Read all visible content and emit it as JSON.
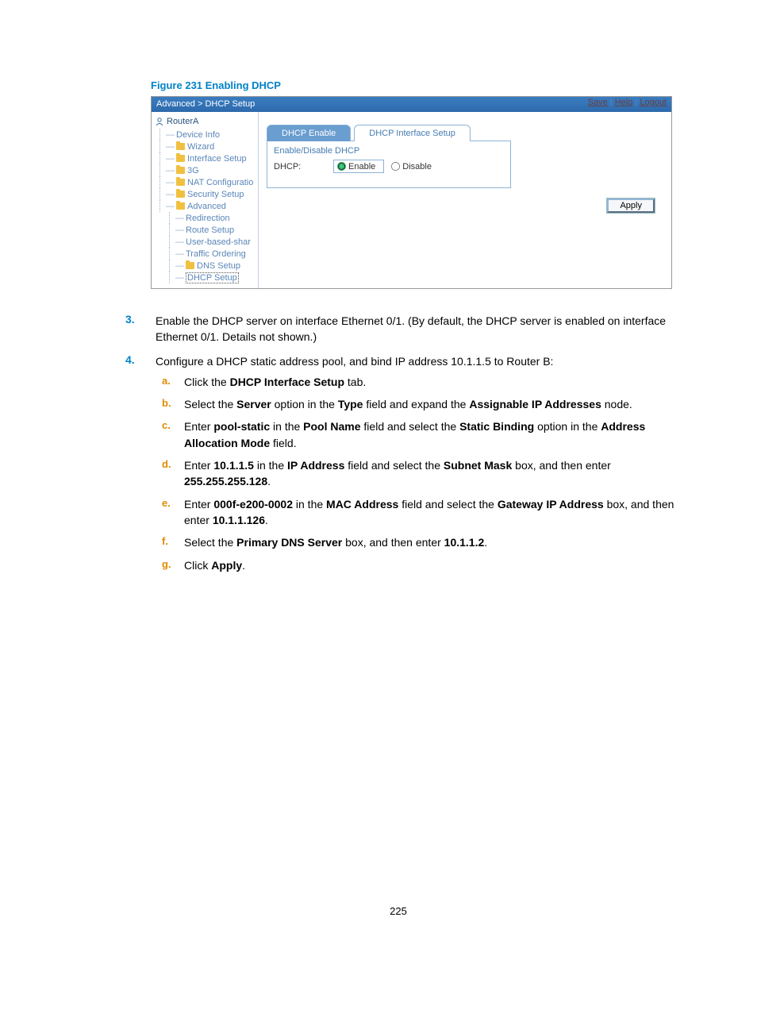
{
  "figure_title": "Figure 231 Enabling DHCP",
  "breadcrumb": "Advanced > DHCP Setup",
  "top_links": {
    "save": "Save",
    "help": "Help",
    "logout": "Logout"
  },
  "nav": {
    "root": "RouterA",
    "items": [
      {
        "label": "Device Info",
        "icon": null
      },
      {
        "label": "Wizard",
        "icon": "folder"
      },
      {
        "label": "Interface Setup",
        "icon": "folder"
      },
      {
        "label": "3G",
        "icon": "folder"
      },
      {
        "label": "NAT Configuratio",
        "icon": "folder"
      },
      {
        "label": "Security Setup",
        "icon": "folder"
      },
      {
        "label": "Advanced",
        "icon": "folder",
        "sub": [
          {
            "label": "Redirection"
          },
          {
            "label": "Route Setup"
          },
          {
            "label": "User-based-shar"
          },
          {
            "label": "Traffic Ordering"
          },
          {
            "label": "DNS Setup",
            "icon": "folder"
          },
          {
            "label": "DHCP Setup",
            "selected": true
          }
        ]
      }
    ]
  },
  "tabs": {
    "active": "DHCP Enable",
    "other": "DHCP Interface Setup"
  },
  "panel": {
    "legend": "Enable/Disable DHCP",
    "field_label": "DHCP:",
    "enable": "Enable",
    "disable": "Disable",
    "apply": "Apply"
  },
  "steps": {
    "s3": {
      "num": "3.",
      "text": "Enable the DHCP server on interface Ethernet 0/1. (By default, the DHCP server is enabled on interface Ethernet 0/1. Details not shown.)"
    },
    "s4": {
      "num": "4.",
      "text": "Configure a DHCP static address pool, and bind IP address 10.1.1.5 to Router B:",
      "a": {
        "pre": "Click the ",
        "b1": "DHCP Interface Setup",
        "post": " tab."
      },
      "b": {
        "pre": "Select the ",
        "b1": "Server",
        "mid1": " option in the ",
        "b2": "Type",
        "mid2": " field and expand the ",
        "b3": "Assignable IP Addresses",
        "post": " node."
      },
      "c": {
        "pre": "Enter ",
        "b1": "pool-static",
        "mid1": " in the ",
        "b2": "Pool Name",
        "mid2": " field and select the ",
        "b3": "Static Binding",
        "mid3": " option in the ",
        "b4": "Address Allocation Mode",
        "post": " field."
      },
      "d": {
        "pre": "Enter ",
        "b1": "10.1.1.5",
        "mid1": " in the ",
        "b2": "IP Address",
        "mid2": " field and select the ",
        "b3": "Subnet Mask",
        "mid3": " box, and then enter ",
        "b4": "255.255.255.128",
        "post": "."
      },
      "e": {
        "pre": "Enter ",
        "b1": "000f-e200-0002",
        "mid1": " in the ",
        "b2": "MAC Address",
        "mid2": " field and select the ",
        "b3": "Gateway IP Address",
        "mid3": " box, and then enter ",
        "b4": "10.1.1.126",
        "post": "."
      },
      "f": {
        "pre": "Select the ",
        "b1": "Primary DNS Server",
        "mid1": " box, and then enter ",
        "b2": "10.1.1.2",
        "post": "."
      },
      "g": {
        "pre": "Click ",
        "b1": "Apply",
        "post": "."
      }
    }
  },
  "page_number": "225"
}
